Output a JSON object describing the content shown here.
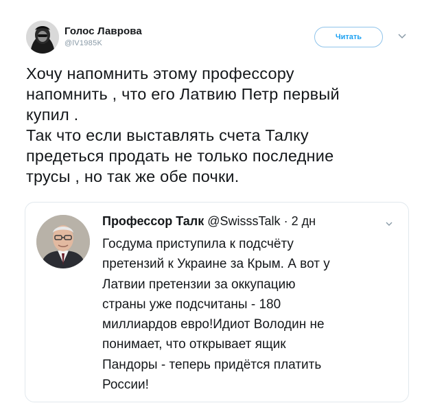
{
  "author": {
    "name": "Голос Лаврова",
    "handle": "@lV1985K",
    "avatar_icon": "dark-hooded-avatar"
  },
  "follow_button": {
    "label": "Читать",
    "color": "#1da1f2"
  },
  "menu_icon": "chevron-down-icon",
  "tweet_lines": [
    "Хочу напомнить этому профессору",
    "напомнить , что его Латвию Петр первый",
    "купил .",
    "Так что если выставлять счета Талку",
    "предеться продать не только последние",
    "трусы , но так же обе почки."
  ],
  "quoted_tweet": {
    "author_name": "Профессор Талк",
    "handle": "@SwisssTalk",
    "separator": "·",
    "time": "2 дн",
    "avatar_icon": "elderly-man-glasses-avatar",
    "menu_icon": "chevron-down-icon",
    "lines": [
      "Госдума приступила к подсчёту",
      "претензий к Украине за Крым. А вот у",
      "Латвии претензии за оккупацию",
      "страны уже подсчитаны - 180",
      "миллиардов евро!Идиот Володин не",
      "понимает, что открывает ящик",
      "Пандоры - теперь придётся платить",
      "России!"
    ]
  }
}
